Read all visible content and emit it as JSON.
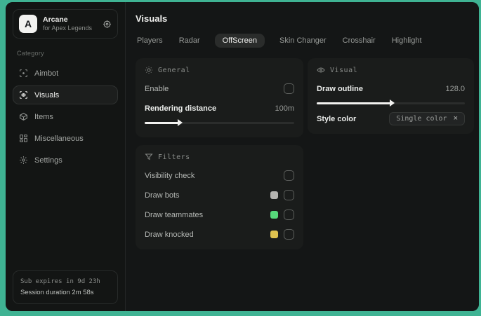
{
  "app": {
    "logo_letter": "A",
    "title": "Arcane",
    "subtitle": "for Apex Legends"
  },
  "sidebar": {
    "category_label": "Category",
    "items": [
      {
        "label": "Aimbot",
        "icon": "crosshair-scan-icon",
        "selected": false
      },
      {
        "label": "Visuals",
        "icon": "eye-scan-icon",
        "selected": true
      },
      {
        "label": "Items",
        "icon": "cube-icon",
        "selected": false
      },
      {
        "label": "Miscellaneous",
        "icon": "layout-grid-icon",
        "selected": false
      },
      {
        "label": "Settings",
        "icon": "gear-icon",
        "selected": false
      }
    ],
    "footer": {
      "line1": "Sub expires in 9d 23h",
      "line2": "Session duration 2m 58s"
    }
  },
  "main": {
    "title": "Visuals",
    "tabs": [
      {
        "label": "Players",
        "selected": false
      },
      {
        "label": "Radar",
        "selected": false
      },
      {
        "label": "OffScreen",
        "selected": true
      },
      {
        "label": "Skin Changer",
        "selected": false
      },
      {
        "label": "Crosshair",
        "selected": false
      },
      {
        "label": "Highlight",
        "selected": false
      }
    ],
    "general_card": {
      "header": "General",
      "enable_label": "Enable",
      "enable_checked": false,
      "rendering_label": "Rendering distance",
      "rendering_value": "100m",
      "slider_percent": 23
    },
    "filters_card": {
      "header": "Filters",
      "rows": [
        {
          "label": "Visibility check",
          "swatch": null,
          "checked": false
        },
        {
          "label": "Draw bots",
          "swatch": "#b3b3b0",
          "checked": false
        },
        {
          "label": "Draw teammates",
          "swatch": "#56d97b",
          "checked": false
        },
        {
          "label": "Draw knocked",
          "swatch": "#dfc24f",
          "checked": false
        }
      ]
    },
    "visual_card": {
      "header": "Visual",
      "outline_label": "Draw outline",
      "outline_value": "128.0",
      "slider_percent": 50,
      "style_label": "Style color",
      "style_value": "Single color",
      "clear_glyph": "×"
    }
  },
  "colors": {
    "desktop_background": "#3fb393",
    "window_background": "#141616",
    "card_background": "#1a1c1b",
    "accent_text": "#eceeec",
    "muted_text": "#9a9d9a",
    "swatch_bots": "#b3b3b0",
    "swatch_teammates": "#56d97b",
    "swatch_knocked": "#dfc24f"
  }
}
